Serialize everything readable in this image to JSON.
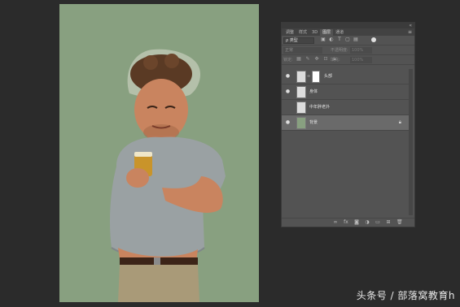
{
  "layers_panel": {
    "tabs": [
      {
        "label": "调整"
      },
      {
        "label": "样式"
      },
      {
        "label": "3D"
      },
      {
        "label": "图层"
      },
      {
        "label": "通道"
      }
    ],
    "active_tab": "图层",
    "filter_select": "ρ 类型",
    "blend_mode": "正常",
    "opacity_label": "不透明度:",
    "opacity_value": "100%",
    "lock_label": "锁定:",
    "fill_label": "填充:",
    "fill_value": "100%",
    "layers": [
      {
        "name": "头部",
        "visible": true,
        "has_mask": true,
        "selected": false
      },
      {
        "name": "身体",
        "visible": true,
        "has_mask": false,
        "selected": false
      },
      {
        "name": "中年胖老外",
        "visible": false,
        "has_mask": false,
        "selected": false
      },
      {
        "name": "背景",
        "visible": true,
        "has_mask": false,
        "selected": true,
        "locked": true
      }
    ]
  },
  "canvas": {
    "background_color": "#88a080"
  },
  "watermark": "头条号 / 部落窝教育h"
}
